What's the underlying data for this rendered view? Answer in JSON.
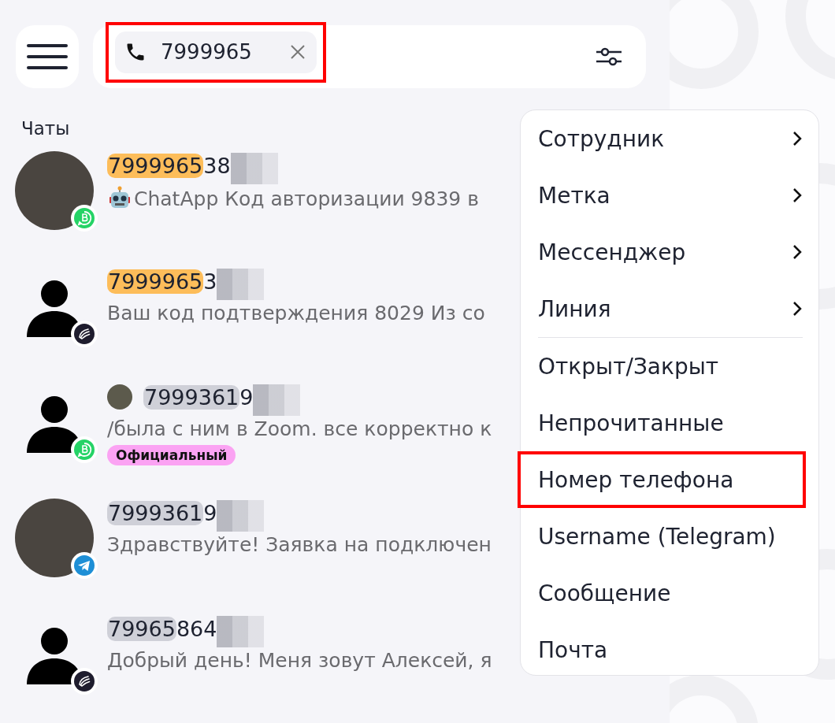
{
  "search": {
    "chip": {
      "value": "7999965",
      "highlighted": true
    }
  },
  "section_title": "Чаты",
  "chats": [
    {
      "avatar": {
        "kind": "photo"
      },
      "badge": {
        "kind": "whatsapp_business"
      },
      "name": {
        "match": {
          "text": "7999965",
          "kind": "strong"
        },
        "rest": "38",
        "redacted": true
      },
      "message": "ChatApp Код авторизации 9839 в",
      "bot": true
    },
    {
      "avatar": {
        "kind": "silhouette"
      },
      "badge": {
        "kind": "custom"
      },
      "name": {
        "match": {
          "text": "7999965",
          "kind": "strong"
        },
        "rest": "3",
        "redacted": true
      },
      "message": "Ваш код подтверждения 8029 Из со"
    },
    {
      "avatar": {
        "kind": "silhouette"
      },
      "badge": {
        "kind": "whatsapp_business"
      },
      "name": {
        "match": {
          "text": "7999361",
          "kind": "weak"
        },
        "rest": "9",
        "redacted": true
      },
      "contact_photo": true,
      "message": "/была с ним в Zoom. все корректно к",
      "tag": {
        "label": "Официальный",
        "color": "#fba3f3"
      }
    },
    {
      "avatar": {
        "kind": "photo"
      },
      "badge": {
        "kind": "telegram"
      },
      "name": {
        "match": {
          "text": "7999361",
          "kind": "weak"
        },
        "rest": "9",
        "redacted": true
      },
      "message": "Здравствуйте! Заявка на подключен"
    },
    {
      "avatar": {
        "kind": "silhouette"
      },
      "badge": {
        "kind": "custom"
      },
      "name": {
        "match": {
          "text": "79965",
          "kind": "weak"
        },
        "rest": "864",
        "redacted": true
      },
      "message": "Добрый день! Меня зовут Алексей, я"
    }
  ],
  "filter_menu": [
    {
      "label": "Сотрудник",
      "submenu": true,
      "highlighted": false,
      "separator_after": false
    },
    {
      "label": "Метка",
      "submenu": true,
      "highlighted": false,
      "separator_after": false
    },
    {
      "label": "Мессенджер",
      "submenu": true,
      "highlighted": false,
      "separator_after": false
    },
    {
      "label": "Линия",
      "submenu": true,
      "highlighted": false,
      "separator_after": true
    },
    {
      "label": "Открыт/Закрыт",
      "submenu": false,
      "highlighted": false,
      "separator_after": false
    },
    {
      "label": "Непрочитанные",
      "submenu": false,
      "highlighted": false,
      "separator_after": false
    },
    {
      "label": "Номер телефона",
      "submenu": false,
      "highlighted": true,
      "separator_after": false
    },
    {
      "label": "Username (Telegram)",
      "submenu": false,
      "highlighted": false,
      "separator_after": false
    },
    {
      "label": "Сообщение",
      "submenu": false,
      "highlighted": false,
      "separator_after": false
    },
    {
      "label": "Почта",
      "submenu": false,
      "highlighted": false,
      "separator_after": false
    }
  ]
}
